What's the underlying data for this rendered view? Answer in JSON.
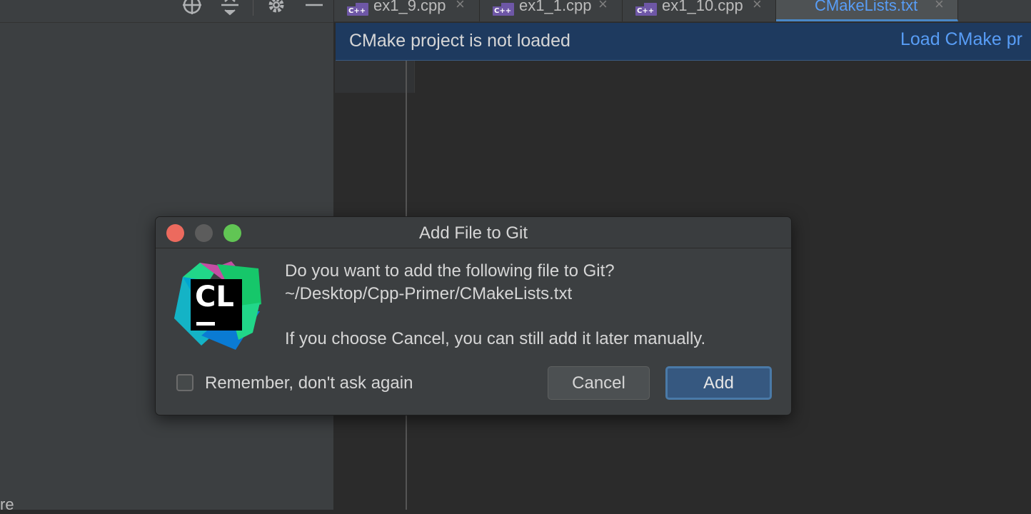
{
  "sidebar": {
    "partial_text": "re"
  },
  "tabs": [
    {
      "label": "ex1_9.cpp",
      "badge": "C++"
    },
    {
      "label": "ex1_1.cpp",
      "badge": "C++"
    },
    {
      "label": "ex1_10.cpp",
      "badge": "C++"
    },
    {
      "label": "CMakeLists.txt",
      "active": true
    }
  ],
  "banner": {
    "message": "CMake project is not loaded",
    "action": "Load CMake pr"
  },
  "dialog": {
    "title": "Add File to Git",
    "question": "Do you want to add the following file to Git?",
    "file_path": "~/Desktop/Cpp-Primer/CMakeLists.txt",
    "note": "If you choose Cancel, you can still add it later manually.",
    "remember_label": "Remember, don't ask again",
    "remember_checked": false,
    "cancel_label": "Cancel",
    "add_label": "Add",
    "logo_text": "CL"
  },
  "colors": {
    "accent": "#589df6",
    "close": "#ec6a5e",
    "minimize": "#5c5c5c",
    "maximize": "#61c554"
  }
}
